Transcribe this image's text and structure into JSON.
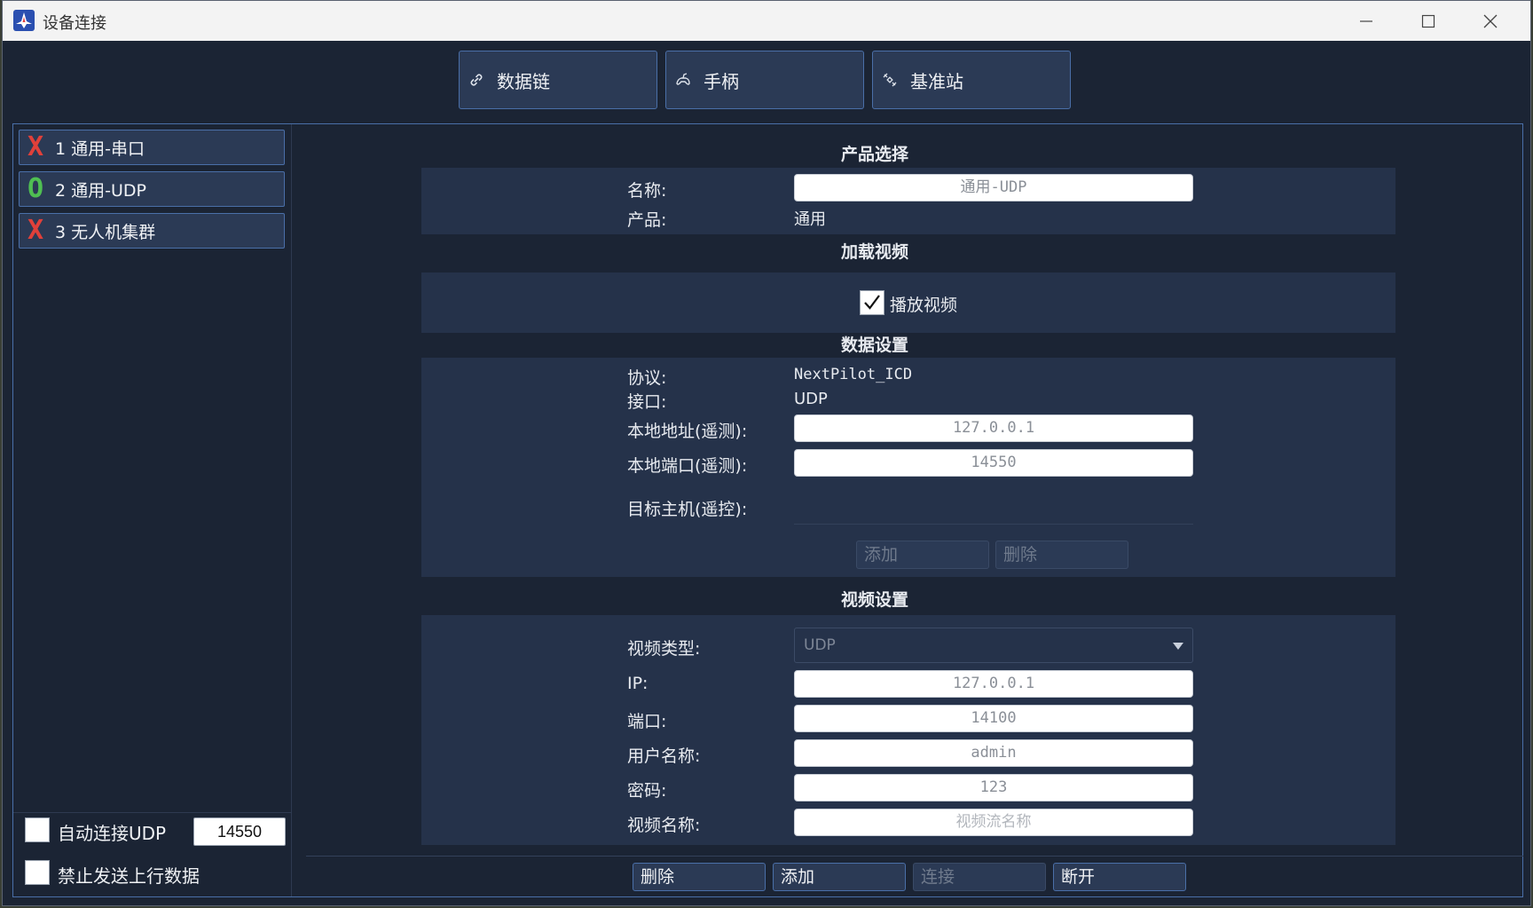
{
  "window": {
    "title": "设备连接",
    "colors": {
      "background": "#1b2434",
      "accent_border": "#4a6fa8",
      "panel": "#25324a",
      "button": "#2b3a55"
    }
  },
  "tabs": [
    {
      "label": "数据链",
      "icon": "link-icon"
    },
    {
      "label": "手柄",
      "icon": "joystick-icon"
    },
    {
      "label": "基准站",
      "icon": "satellite-icon"
    }
  ],
  "sidebar": {
    "items": [
      {
        "status": "X",
        "status_color": "#e0403a",
        "label": "1 通用-串口"
      },
      {
        "status": "O",
        "status_color": "#4fbf52",
        "label": "2 通用-UDP"
      },
      {
        "status": "X",
        "status_color": "#e0403a",
        "label": "3 无人机集群"
      }
    ],
    "auto_connect_label": "自动连接UDP",
    "auto_connect_port": "14550",
    "disable_uplink_label": "禁止发送上行数据"
  },
  "product": {
    "section_title": "产品选择",
    "name_label": "名称:",
    "name_value": "通用-UDP",
    "product_label": "产品:",
    "product_value": "通用"
  },
  "video_load": {
    "section_title": "加载视频",
    "play_label": "播放视频",
    "play_checked": true
  },
  "data_settings": {
    "section_title": "数据设置",
    "protocol_label": "协议:",
    "protocol_value": "NextPilot_ICD",
    "interface_label": "接口:",
    "interface_value": "UDP",
    "local_addr_label": "本地地址(遥测):",
    "local_addr_value": "127.0.0.1",
    "local_port_label": "本地端口(遥测):",
    "local_port_value": "14550",
    "target_host_label": "目标主机(遥控):",
    "add_label": "添加",
    "delete_label": "删除"
  },
  "video_settings": {
    "section_title": "视频设置",
    "type_label": "视频类型:",
    "type_value": "UDP",
    "ip_label": "IP:",
    "ip_value": "127.0.0.1",
    "port_label": "端口:",
    "port_value": "14100",
    "user_label": "用户名称:",
    "user_value": "admin",
    "password_label": "密码:",
    "password_value": "123",
    "stream_label": "视频名称:",
    "stream_placeholder": "视频流名称"
  },
  "bottom_buttons": {
    "delete": "删除",
    "add": "添加",
    "connect": "连接",
    "disconnect": "断开"
  }
}
